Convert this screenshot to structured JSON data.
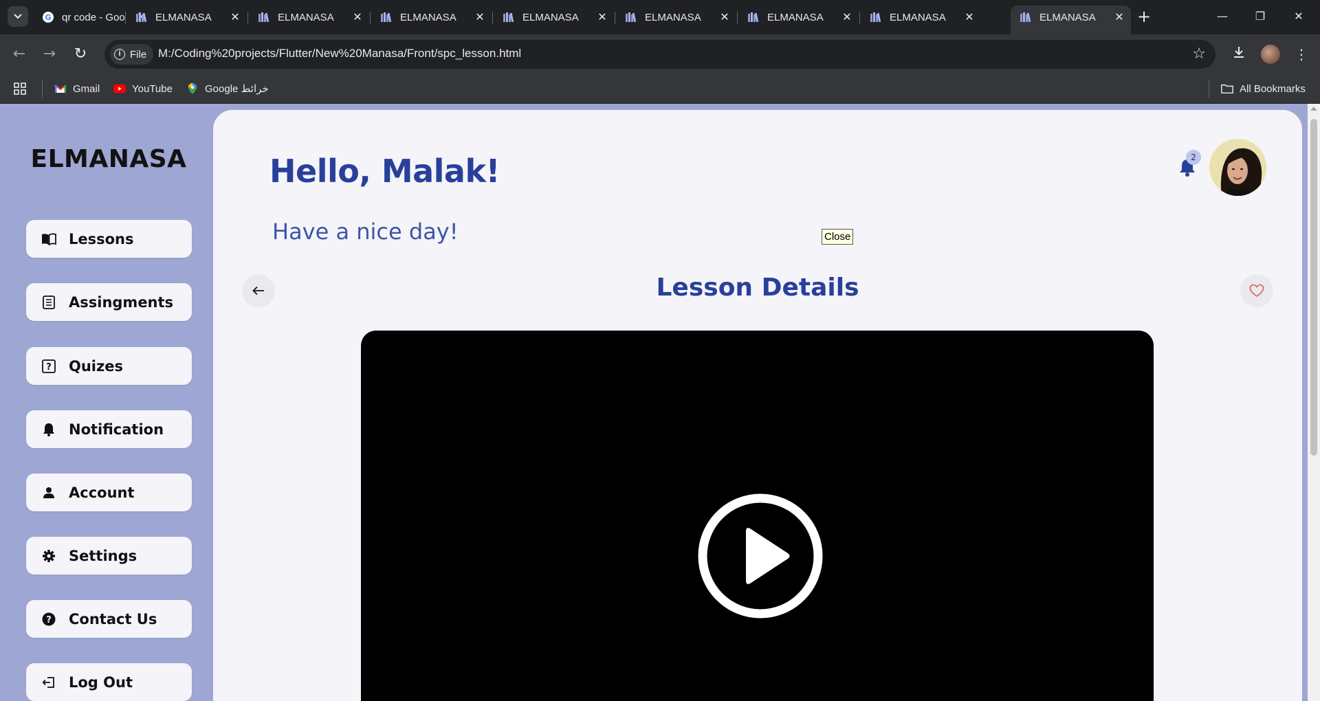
{
  "browser": {
    "tabs": [
      {
        "title": "qr code - Goo",
        "favicon": "google-icon",
        "active": false
      },
      {
        "title": "ELMANASA",
        "favicon": "books-icon",
        "active": false
      },
      {
        "title": "ELMANASA",
        "favicon": "books-icon",
        "active": false
      },
      {
        "title": "ELMANASA",
        "favicon": "books-icon",
        "active": false
      },
      {
        "title": "ELMANASA",
        "favicon": "books-icon",
        "active": false
      },
      {
        "title": "ELMANASA",
        "favicon": "books-icon",
        "active": false
      },
      {
        "title": "ELMANASA",
        "favicon": "books-icon",
        "active": false
      },
      {
        "title": "ELMANASA",
        "favicon": "books-icon",
        "active": false
      },
      {
        "title": "ELMANASA",
        "favicon": "books-icon",
        "active": true
      }
    ],
    "address": {
      "chip_label": "File",
      "url": "M:/Coding%20projects/Flutter/New%20Manasa/Front/spc_lesson.html"
    },
    "bookmarks": [
      {
        "label": "Gmail",
        "icon": "gmail-icon"
      },
      {
        "label": "YouTube",
        "icon": "youtube-icon"
      },
      {
        "label": "Google خرائط",
        "icon": "maps-icon"
      }
    ],
    "all_bookmarks_label": "All Bookmarks"
  },
  "sidebar": {
    "brand": "ELMANASA",
    "items": [
      {
        "label": "Lessons",
        "icon": "book-open-icon"
      },
      {
        "label": "Assingments",
        "icon": "list-icon"
      },
      {
        "label": "Quizes",
        "icon": "question-square-icon"
      },
      {
        "label": "Notification",
        "icon": "bell-icon"
      },
      {
        "label": "Account",
        "icon": "user-icon"
      },
      {
        "label": "Settings",
        "icon": "gear-icon"
      },
      {
        "label": "Contact Us",
        "icon": "help-circle-icon"
      },
      {
        "label": "Log Out",
        "icon": "logout-icon"
      }
    ]
  },
  "header": {
    "greeting": "Hello, Malak!",
    "subgreeting": "Have a nice day!",
    "notification_count": "2",
    "tooltip": "Close"
  },
  "lesson": {
    "title": "Lesson Details"
  },
  "colors": {
    "sidebar_bg": "#9ea7d3",
    "primary": "#29409a",
    "card_bg": "#f4f4f9",
    "favorite": "#e05a5a"
  }
}
